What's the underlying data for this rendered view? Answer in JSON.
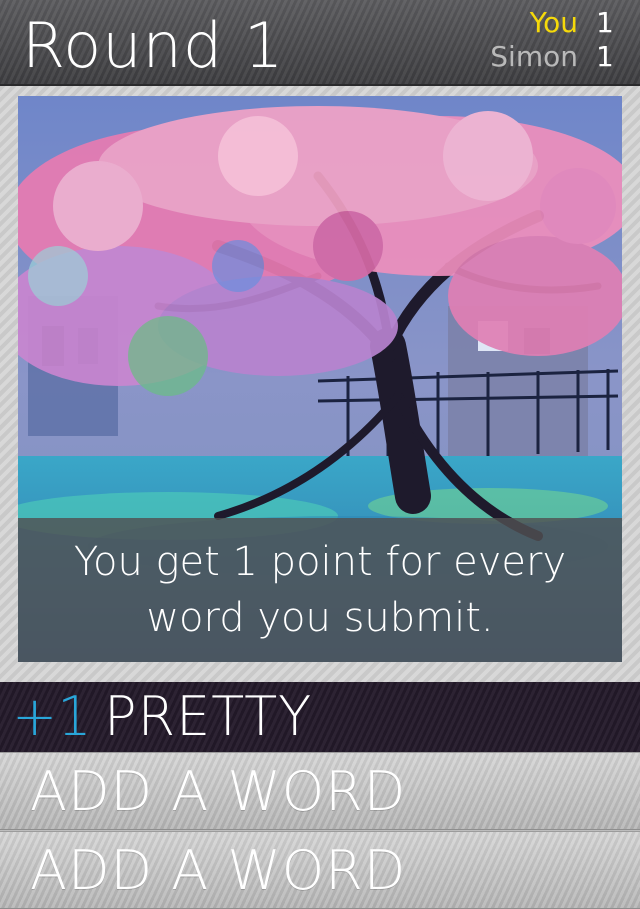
{
  "header": {
    "round_title": "Round 1",
    "scores": [
      {
        "name": "You",
        "value": "1",
        "color": "#f5d90a"
      },
      {
        "name": "Simon",
        "value": "1",
        "color": "#b9b9b9"
      }
    ]
  },
  "main": {
    "image_icon": "cherry-blossom-painting",
    "tip": "You get 1 point for every word you submit."
  },
  "words": {
    "submitted": [
      {
        "points": "+1",
        "word": "PRETTY"
      }
    ],
    "add_slots": [
      {
        "label": "ADD A WORD"
      },
      {
        "label": "ADD A WORD"
      }
    ]
  },
  "colors": {
    "accent_points": "#29a6d9",
    "you_highlight": "#f5d90a",
    "submitted_bg": "#251b2c"
  }
}
